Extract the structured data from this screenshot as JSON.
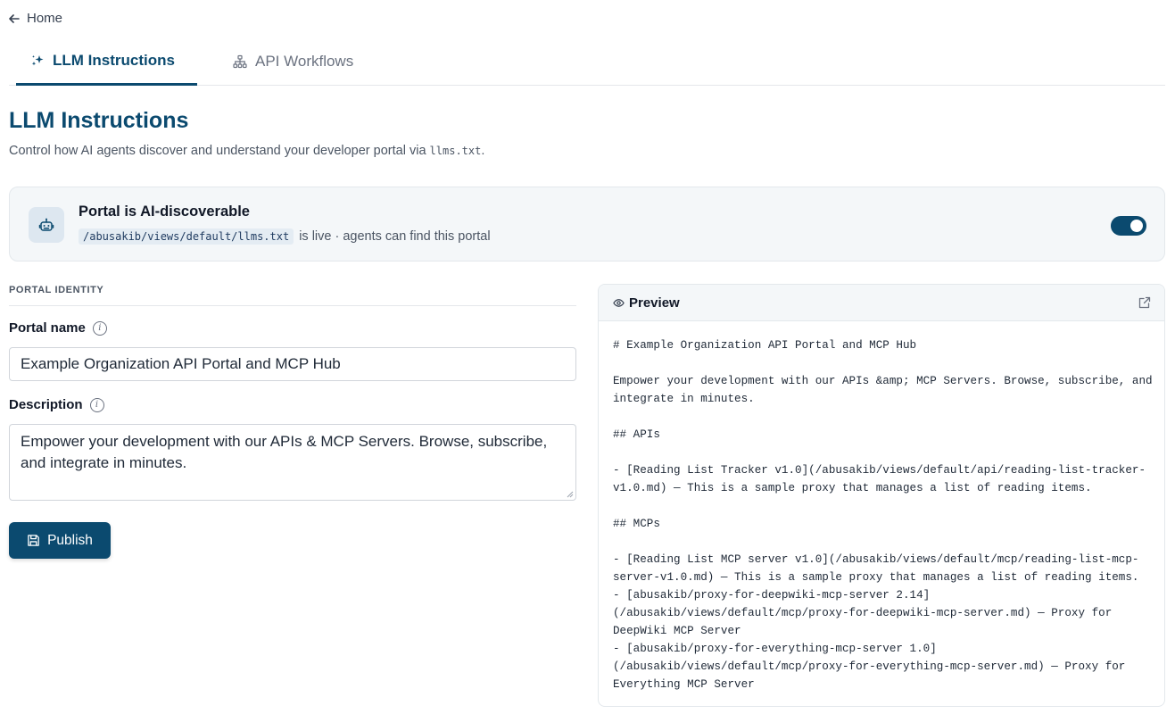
{
  "nav": {
    "back_label": "Home"
  },
  "tabs": [
    {
      "label": "LLM Instructions",
      "icon": "sparkles-icon",
      "active": true
    },
    {
      "label": "API Workflows",
      "icon": "workflow-icon",
      "active": false
    }
  ],
  "header": {
    "title": "LLM Instructions",
    "subtitle_prefix": "Control how AI agents discover and understand your developer portal via",
    "subtitle_code": "llms.txt",
    "subtitle_suffix": "."
  },
  "banner": {
    "icon": "robot-icon",
    "title": "Portal is AI-discoverable",
    "path": "/abusakib/views/default/llms.txt",
    "status_text": "is live · agents can find this portal",
    "toggle_on": true
  },
  "form": {
    "section_label": "PORTAL IDENTITY",
    "portal_name_label": "Portal name",
    "portal_name_value": "Example Organization API Portal and MCP Hub",
    "description_label": "Description",
    "description_value": "Empower your development with our APIs & MCP Servers. Browse, subscribe, and integrate in minutes.",
    "publish_label": "Publish"
  },
  "preview": {
    "title": "Preview",
    "lines": [
      "# Example Organization API Portal and MCP Hub",
      "",
      "Empower your development with our APIs &amp; MCP Servers. Browse, subscribe, and",
      "integrate in minutes.",
      "",
      "## APIs",
      "",
      "- [Reading List Tracker v1.0](/abusakib/views/default/api/reading-list-tracker-",
      "v1.0.md) — This is a sample proxy that manages a list of reading items.",
      "",
      "## MCPs",
      "",
      "- [Reading List MCP server v1.0](/abusakib/views/default/mcp/reading-list-mcp-",
      "server-v1.0.md) — This is a sample proxy that manages a list of reading items.",
      "- [abusakib/proxy-for-deepwiki-mcp-server 2.14]",
      "(/abusakib/views/default/mcp/proxy-for-deepwiki-mcp-server.md) — Proxy for",
      "DeepWiki MCP Server",
      "- [abusakib/proxy-for-everything-mcp-server 1.0]",
      "(/abusakib/views/default/mcp/proxy-for-everything-mcp-server.md) — Proxy for",
      "Everything MCP Server"
    ]
  },
  "colors": {
    "brand": "#0b4a6f",
    "banner_bg": "#f4f7f9",
    "code_bg": "#e4ecf3"
  }
}
